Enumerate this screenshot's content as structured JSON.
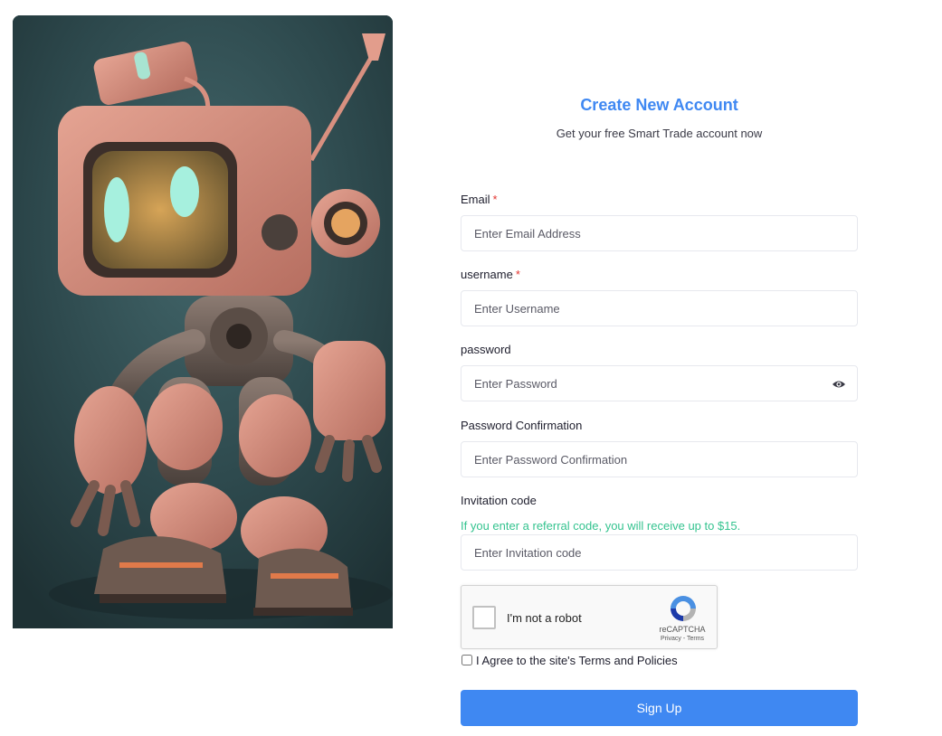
{
  "header": {
    "title": "Create New Account",
    "subtitle": "Get your free Smart Trade account now"
  },
  "fields": {
    "email": {
      "label": "Email",
      "required_mark": "*",
      "placeholder": "Enter Email Address"
    },
    "username": {
      "label": "username",
      "required_mark": "*",
      "placeholder": "Enter Username"
    },
    "password": {
      "label": "password",
      "placeholder": "Enter Password",
      "toggle_icon": "eye-icon"
    },
    "password_confirmation": {
      "label": "Password Confirmation",
      "placeholder": "Enter Password Confirmation"
    },
    "invitation_code": {
      "label": "Invitation code",
      "hint": "If you enter a referral code, you will receive up to $15.",
      "placeholder": "Enter Invitation code"
    }
  },
  "captcha": {
    "label": "I'm not a robot",
    "brand": "reCAPTCHA",
    "links": "Privacy - Terms",
    "icon": "recaptcha-logo-icon"
  },
  "agreement": {
    "label": "I Agree to the site's Terms and Policies",
    "checked": false
  },
  "submit": {
    "label": "Sign Up"
  },
  "colors": {
    "accent": "#3f88f2",
    "required": "#e3342f",
    "hint": "#34c38f",
    "input_border": "#e6e8ee"
  }
}
